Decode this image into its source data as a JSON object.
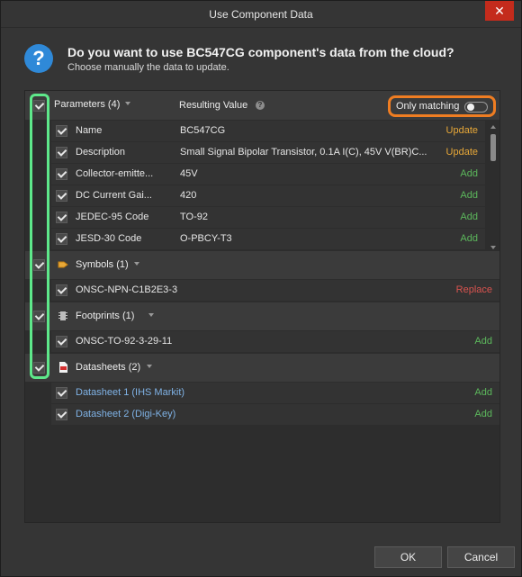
{
  "window": {
    "title": "Use Component Data",
    "close_glyph": "✕"
  },
  "header": {
    "icon_glyph": "?",
    "question": "Do you want to use BC547CG component's data from the cloud?",
    "subtitle": "Choose manually the data to update."
  },
  "parameters": {
    "label": "Parameters (4)",
    "resulting_value_label": "Resulting Value",
    "only_matching_label": "Only matching",
    "only_matching_on": false,
    "rows": [
      {
        "name": "Name",
        "value": "BC547CG",
        "action": "Update"
      },
      {
        "name": "Description",
        "value": "Small Signal Bipolar Transistor, 0.1A I(C), 45V V(BR)C...",
        "action": "Update"
      },
      {
        "name": "Collector-emitte...",
        "value": "45V",
        "action": "Add"
      },
      {
        "name": "DC Current Gai...",
        "value": "420",
        "action": "Add"
      },
      {
        "name": "JEDEC-95 Code",
        "value": "TO-92",
        "action": "Add"
      },
      {
        "name": "JESD-30 Code",
        "value": "O-PBCY-T3",
        "action": "Add"
      }
    ]
  },
  "symbols": {
    "label": "Symbols (1)",
    "rows": [
      {
        "name": "ONSC-NPN-C1B2E3-3",
        "action": "Replace"
      }
    ]
  },
  "footprints": {
    "label": "Footprints (1)",
    "rows": [
      {
        "name": "ONSC-TO-92-3-29-11",
        "action": "Add"
      }
    ]
  },
  "datasheets": {
    "label": "Datasheets (2)",
    "rows": [
      {
        "name": "Datasheet 1 (IHS Markit)",
        "action": "Add"
      },
      {
        "name": "Datasheet 2 (Digi-Key)",
        "action": "Add"
      }
    ]
  },
  "footer": {
    "ok_label": "OK",
    "cancel_label": "Cancel"
  },
  "colors": {
    "update": "#e8a838",
    "add": "#5cb85c",
    "replace": "#d9534f",
    "highlight_green": "#5ee88a",
    "highlight_orange": "#ef7d22"
  }
}
